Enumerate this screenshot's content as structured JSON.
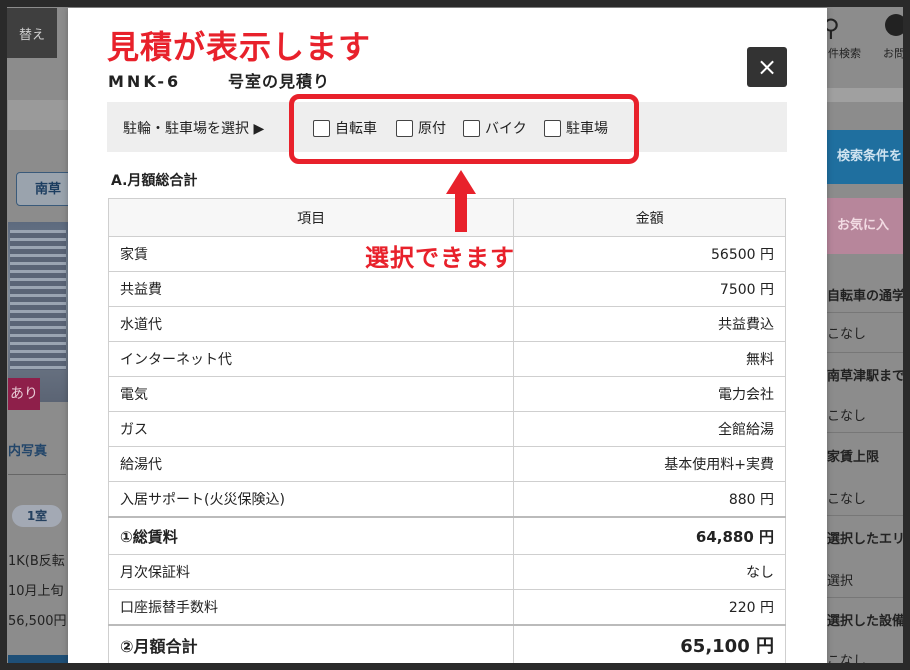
{
  "background": {
    "header_btn": "替え",
    "search_label": "件検索",
    "user_label": "お問",
    "station_tab": "南草",
    "badge_ari": "あり",
    "photo_tab": "内写真",
    "room_pill": "1室",
    "room_type": "1K(B反転",
    "move_in": "10月上旬",
    "rent": "56,500円",
    "right_blue": "検索条件を",
    "right_pink": "お気に入",
    "right_items": [
      "自転車の通学",
      "こなし",
      "南草津駅まで",
      "こなし",
      "家賃上限",
      "こなし",
      "選択したエリ",
      "選択",
      "選択した設備",
      "こなし"
    ]
  },
  "overlay": {
    "title": "見積が表示します",
    "annotation": "選択できます",
    "accent_color": "#e8212b"
  },
  "modal": {
    "room_code": "MNK-6",
    "room_suffix": "号室の見積り",
    "close_icon": "×",
    "select_label": "駐輪・駐車場を選択 ▶",
    "options": [
      "自転車",
      "原付",
      "バイク",
      "駐車場"
    ],
    "section_title": "A.月額総合計",
    "table": {
      "headers": [
        "項目",
        "金額"
      ],
      "rows": [
        {
          "item": "家賃",
          "amount": "56500 円"
        },
        {
          "item": "共益費",
          "amount": "7500 円"
        },
        {
          "item": "水道代",
          "amount": "共益費込"
        },
        {
          "item": "インターネット代",
          "amount": "無料"
        },
        {
          "item": "電気",
          "amount": "電力会社"
        },
        {
          "item": "ガス",
          "amount": "全館給湯"
        },
        {
          "item": "給湯代",
          "amount": "基本使用料+実費"
        },
        {
          "item": "入居サポート(火災保険込)",
          "amount": "880 円"
        },
        {
          "item": "①総賃料",
          "amount": "64,880 円",
          "type": "total"
        },
        {
          "item": "月次保証料",
          "amount": "なし"
        },
        {
          "item": "口座振替手数料",
          "amount": "220 円"
        },
        {
          "item": "②月額合計",
          "amount": "65,100 円",
          "type": "grand"
        }
      ]
    }
  }
}
